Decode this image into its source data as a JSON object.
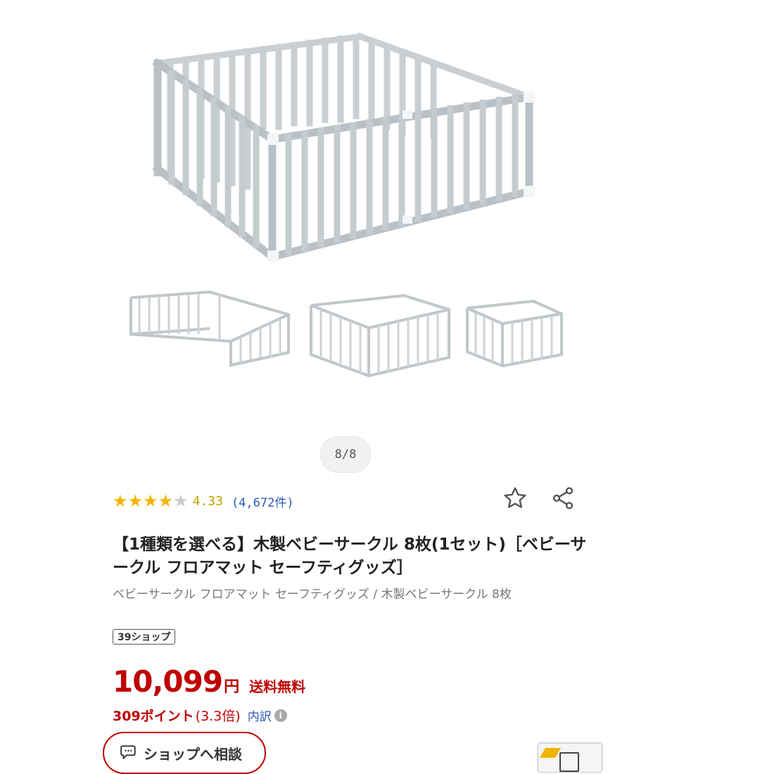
{
  "gallery": {
    "counter": "8/8"
  },
  "rating": {
    "stars_filled": 4,
    "stars_total": 5,
    "value": "4.33",
    "count": "(4,672件)"
  },
  "product": {
    "title": "【1種類を選べる】木製ベビーサークル 8枚(1セット)［ベビーサークル フロアマット セーフティグッズ］",
    "breadcrumb": "ベビーサークル フロアマット セーフティグッズ / 木製ベビーサークル 8枚",
    "badge": "39ショップ"
  },
  "price": {
    "amount": "10,099",
    "currency": "円",
    "shipping": "送料無料"
  },
  "points": {
    "value": "309ポイント",
    "rate": "(3.3倍)",
    "breakdown": "内訳",
    "info": "i"
  },
  "actions": {
    "consult": "ショップへ相談"
  },
  "icons": {
    "favorite": "star-outline-icon",
    "share": "share-icon",
    "chat": "chat-icon",
    "info": "info-icon"
  },
  "colors": {
    "price_red": "#bf0000",
    "star_gold": "#f4b400",
    "link_blue": "#2b59b4"
  }
}
